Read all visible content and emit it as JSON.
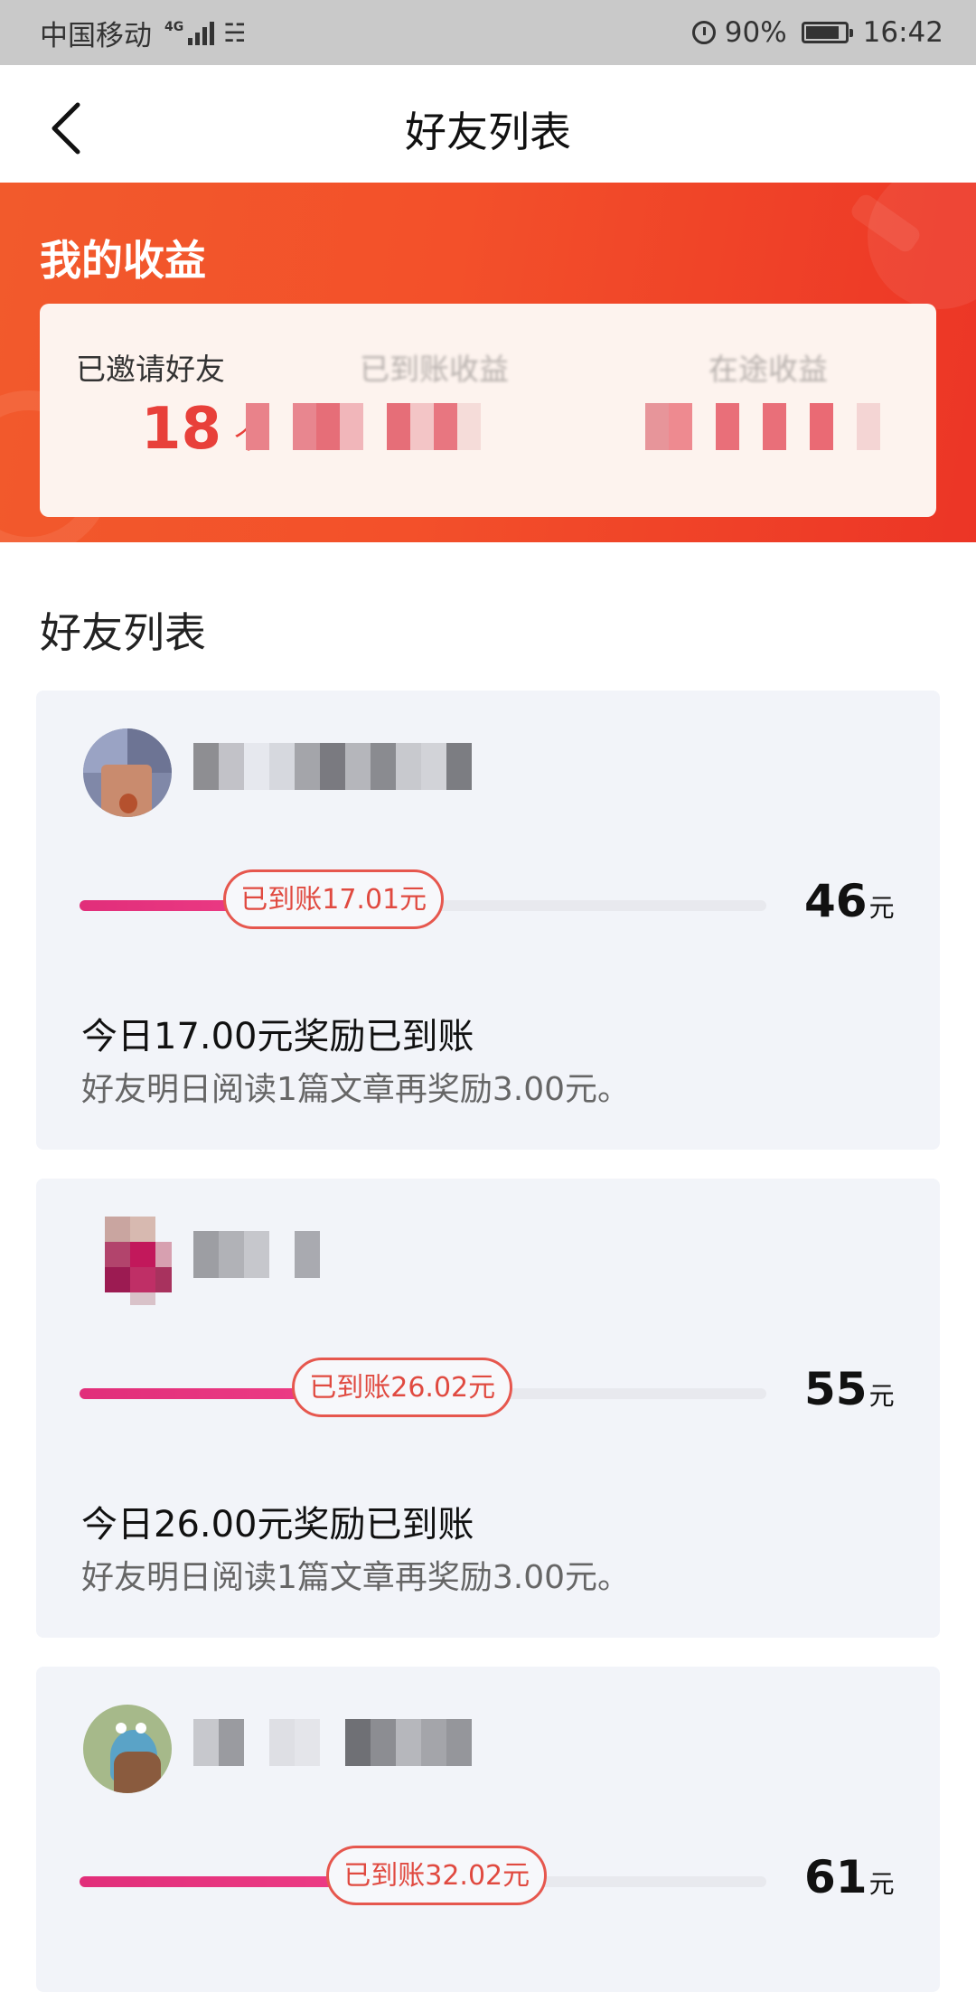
{
  "status_bar": {
    "carrier": "中国移动",
    "network": "4G",
    "battery": "90%",
    "time": "16:42"
  },
  "nav": {
    "title": "好友列表"
  },
  "earnings": {
    "title": "我的收益",
    "invited_label": "已邀请好友",
    "invited_count": "18",
    "invited_unit": "个",
    "received_label": "已到账收益",
    "pending_label": "在途收益"
  },
  "friends_section": {
    "title": "好友列表",
    "friends": [
      {
        "received_badge": "已到账17.01元",
        "progress": 0.37,
        "total": "46",
        "total_unit": "元",
        "line1": "今日17.00元奖励已到账",
        "line2": "好友明日阅读1篇文章再奖励3.00元。"
      },
      {
        "received_badge": "已到账26.02元",
        "progress": 0.47,
        "total": "55",
        "total_unit": "元",
        "line1": "今日26.00元奖励已到账",
        "line2": "好友明日阅读1篇文章再奖励3.00元。"
      },
      {
        "received_badge": "已到账32.02元",
        "progress": 0.52,
        "total": "61",
        "total_unit": "元"
      }
    ]
  }
}
